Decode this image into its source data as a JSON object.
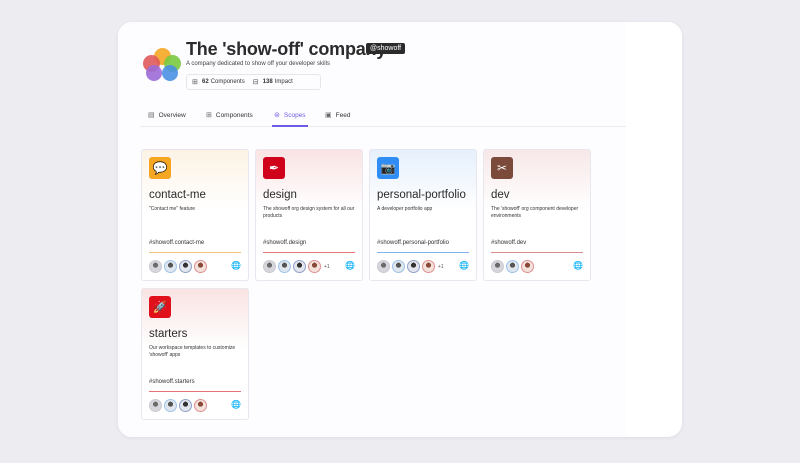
{
  "org": {
    "title": "The 'show-off' company",
    "handle": "@showoff",
    "description": "A company dedicated to show off your developer skills",
    "components_count": "62",
    "components_label": "Components",
    "impact_count": "138",
    "impact_label": "Impact"
  },
  "tabs": [
    {
      "label": "Overview",
      "icon": "overview-icon",
      "active": false
    },
    {
      "label": "Components",
      "icon": "components-grid-icon",
      "active": false
    },
    {
      "label": "Scopes",
      "icon": "scopes-icon",
      "active": true
    },
    {
      "label": "Feed",
      "icon": "feed-icon",
      "active": false
    }
  ],
  "accent_color": "#6c5ce7",
  "scopes": [
    {
      "name": "contact-me",
      "description": "\"Contact me\" feature",
      "id": "#showoff.contact-me",
      "icon": "chat-bubbles-icon",
      "icon_color": "#f5a623",
      "accent": "#f0c27a",
      "avatars": 4,
      "extra": ""
    },
    {
      "name": "design",
      "description": "The showoff org design system for all our products",
      "id": "#showoff.design",
      "icon": "design-tool-icon",
      "icon_color": "#d0021b",
      "accent": "#e57373",
      "avatars": 4,
      "extra": "+1"
    },
    {
      "name": "personal-portfolio",
      "description": "A developer portfolio app",
      "id": "#showoff.personal-portfolio",
      "icon": "camera-icon",
      "icon_color": "#2f8df5",
      "accent": "#7fb3f0",
      "avatars": 4,
      "extra": "+1"
    },
    {
      "name": "dev",
      "description": "The 'showoff' org component developer environments",
      "id": "#showoff.dev",
      "icon": "tools-icon",
      "icon_color": "#7b4a3a",
      "accent": "#d98a8a",
      "avatars": 3,
      "extra": ""
    },
    {
      "name": "starters",
      "description": "Our workspace templates to customize 'showoff' apps",
      "id": "#showoff.starters",
      "icon": "rocket-icon",
      "icon_color": "#e0111b",
      "accent": "#e57373",
      "avatars": 4,
      "extra": ""
    }
  ]
}
